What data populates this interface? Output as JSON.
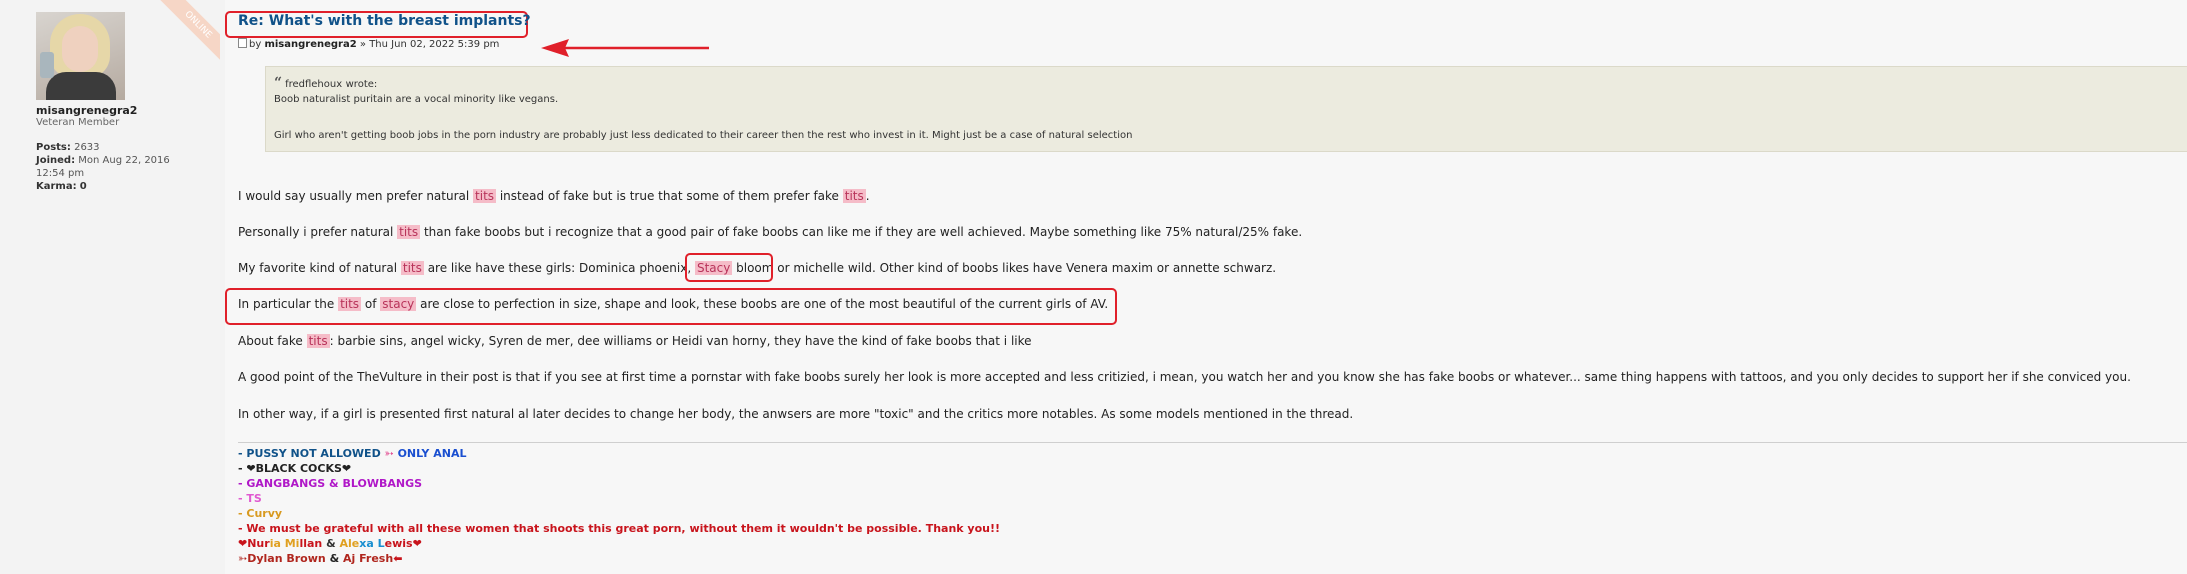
{
  "profile": {
    "online_badge": "ONLINE",
    "username": "misangrenegra2",
    "rank": "Veteran Member",
    "posts_label": "Posts:",
    "posts_value": "2633",
    "joined_label": "Joined:",
    "joined_value": "Mon Aug 22, 2016 12:54 pm",
    "karma_label": "Karma:",
    "karma_value": "0"
  },
  "post": {
    "title": "Re: What's with the breast implants?",
    "by": "by",
    "author": "misangrenegra2",
    "sep": "»",
    "date": "Thu Jun 02, 2022 5:39 pm"
  },
  "quote": {
    "author": "fredflehoux",
    "wrote": "wrote:",
    "line1": "Boob naturalist puritain are a vocal minority like vegans.",
    "line2": "Girl who aren't getting boob jobs in the porn industry are probably just less dedicated to their career then the rest who invest in it. Might just be a case of natural selection"
  },
  "body": {
    "p1": [
      "I would say usually men prefer natural ",
      "tits",
      " instead of fake but is true that some of them prefer fake ",
      "tits",
      "."
    ],
    "p2": [
      "Personally i prefer natural ",
      "tits",
      " than fake boobs but i recognize that a good pair of fake boobs can like me if they are well achieved. Maybe something like 75% natural/25% fake."
    ],
    "p3": [
      "My favorite kind of natural ",
      "tits",
      " are like have these girls: Dominica phoenix, ",
      "Stacy",
      " bloom",
      " or michelle wild. Other kind of boobs likes have Venera maxim or annette schwarz."
    ],
    "p4": [
      "In particular the ",
      "tits",
      " of ",
      "stacy",
      " are close to perfection in size, shape and look, these boobs are one of the most beautiful of the current girls of AV."
    ],
    "p5": [
      "About fake ",
      "tits",
      ": barbie sins, angel wicky, Syren de mer, dee williams or Heidi van horny, they have the kind of fake boobs that i like"
    ],
    "p6": "A good point of the TheVulture in their post is that if you see at first time a pornstar with fake boobs surely her look is more accepted and less critizied, i mean, you watch her and you know she has fake boobs or whatever... same thing happens with tattoos, and you only decides to support her if she conviced you.",
    "p7": "In other way, if a girl is presented first natural al later decides to change her body, the anwsers are more \"toxic\" and the critics more notables. As some models mentioned in the thread."
  },
  "signature": {
    "s1a": "- PUSSY NOT ALLOWED ",
    "s1b": "➳",
    "s1c": " ONLY ANAL",
    "s2": "- ❤BLACK COCKS❤",
    "s3": "- GANGBANGS & BLOWBANGS",
    "s4": "- TS",
    "s5": "- Curvy",
    "s6": "- We must be grateful with all these women that shoots this great porn, without them it wouldn't be possible. Thank you!!",
    "s7a": "❤Nur",
    "s7b": "ia Mi",
    "s7c": "llan",
    "s7d": " & ",
    "s7e": "Ale",
    "s7f": "xa L",
    "s7g": "ewis",
    "s7h": "❤",
    "s8a": "➳Dylan Brown",
    "s8b": " & ",
    "s8c": "Aj Fresh",
    "s8d": "⬅"
  },
  "colors": {
    "highlight_bg": "#f5bcc8",
    "highlight_text": "#b8335a",
    "annotation_red": "#e0202a",
    "title_blue": "#105289"
  }
}
